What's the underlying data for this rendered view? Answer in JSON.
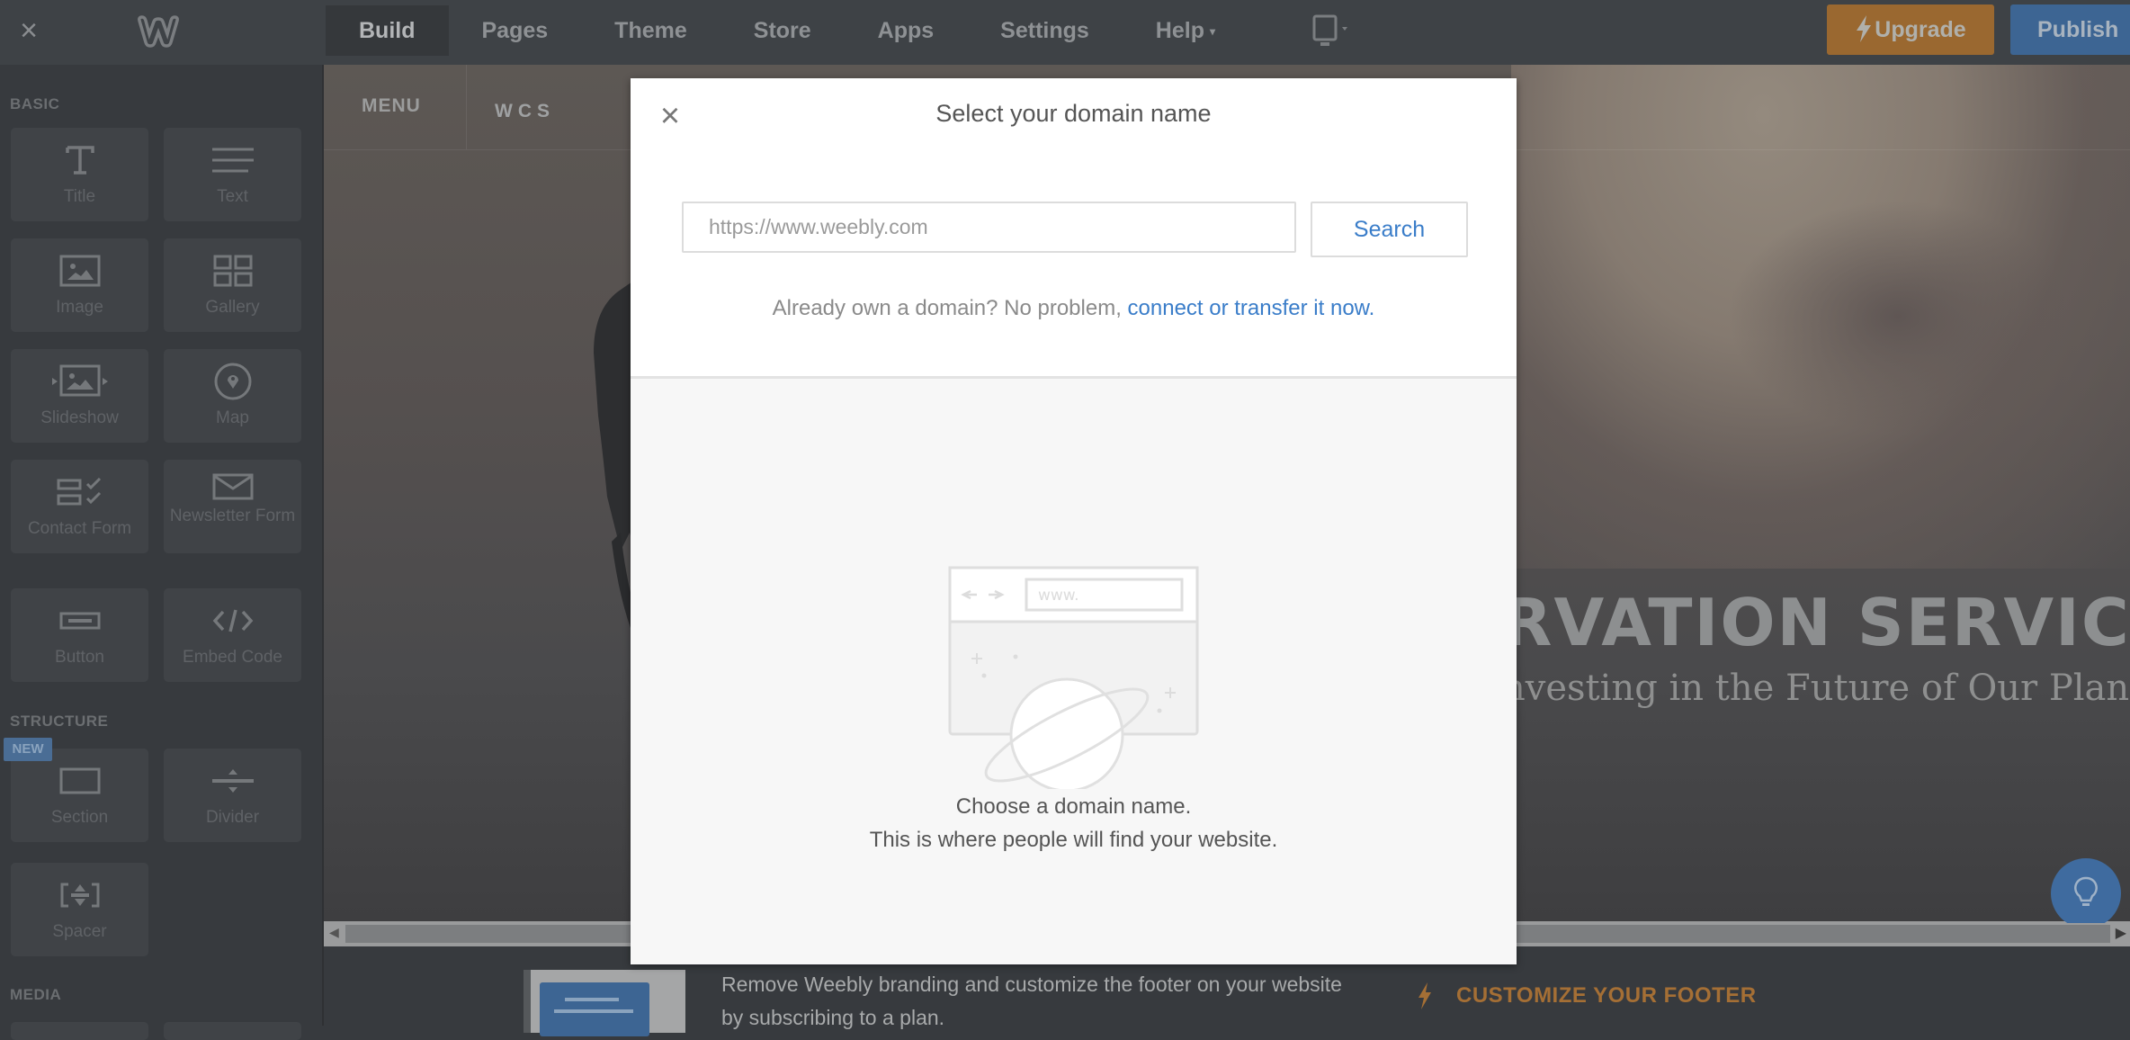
{
  "topbar": {
    "close_icon": "close-icon",
    "logo_icon": "weebly-logo-icon",
    "tabs": [
      {
        "label": "Build",
        "active": true
      },
      {
        "label": "Pages"
      },
      {
        "label": "Theme"
      },
      {
        "label": "Store"
      },
      {
        "label": "Apps"
      },
      {
        "label": "Settings"
      },
      {
        "label": "Help",
        "caret": "▾"
      }
    ],
    "device_icon": "desktop-device-icon",
    "upgrade_label": "Upgrade",
    "publish_label": "Publish",
    "colors": {
      "upgrade": "#9a6830",
      "publish": "#3d6593"
    }
  },
  "sidebar": {
    "sections": {
      "basic": "BASIC",
      "structure": "STRUCTURE",
      "media": "MEDIA"
    },
    "new_badge": "NEW",
    "basic_items": [
      {
        "label": "Title",
        "icon": "title-icon"
      },
      {
        "label": "Text",
        "icon": "text-icon"
      },
      {
        "label": "Image",
        "icon": "image-icon"
      },
      {
        "label": "Gallery",
        "icon": "gallery-icon"
      },
      {
        "label": "Slideshow",
        "icon": "slideshow-icon"
      },
      {
        "label": "Map",
        "icon": "map-pin-icon"
      },
      {
        "label": "Contact Form",
        "icon": "contact-form-icon"
      },
      {
        "label": "Newsletter Form",
        "icon": "envelope-icon"
      },
      {
        "label": "Button",
        "icon": "button-icon"
      },
      {
        "label": "Embed Code",
        "icon": "code-icon"
      }
    ],
    "structure_items": [
      {
        "label": "Section",
        "icon": "section-icon"
      },
      {
        "label": "Divider",
        "icon": "divider-icon"
      },
      {
        "label": "Spacer",
        "icon": "spacer-icon"
      }
    ]
  },
  "site": {
    "menu_label": "MENU",
    "brand": "WCS",
    "hero_title": "RVATION SERVICES",
    "hero_subtitle": "nvesting in the Future of Our Planet"
  },
  "modal": {
    "title": "Select your domain name",
    "search_placeholder": "https://www.weebly.com",
    "search_value": "",
    "search_button": "Search",
    "already_text": "Already own a domain? No problem, ",
    "already_link": "connect or transfer it now.",
    "illustration_url_text": "www.",
    "choose_line1": "Choose a domain name.",
    "choose_line2": "This is where people will find your website.",
    "link_color": "#3a7dc9"
  },
  "footer_banner": {
    "text": "Remove Weebly branding and customize the footer on your website by subscribing to a plan.",
    "cta": "CUSTOMIZE YOUR FOOTER",
    "cta_color": "#a56f35"
  }
}
